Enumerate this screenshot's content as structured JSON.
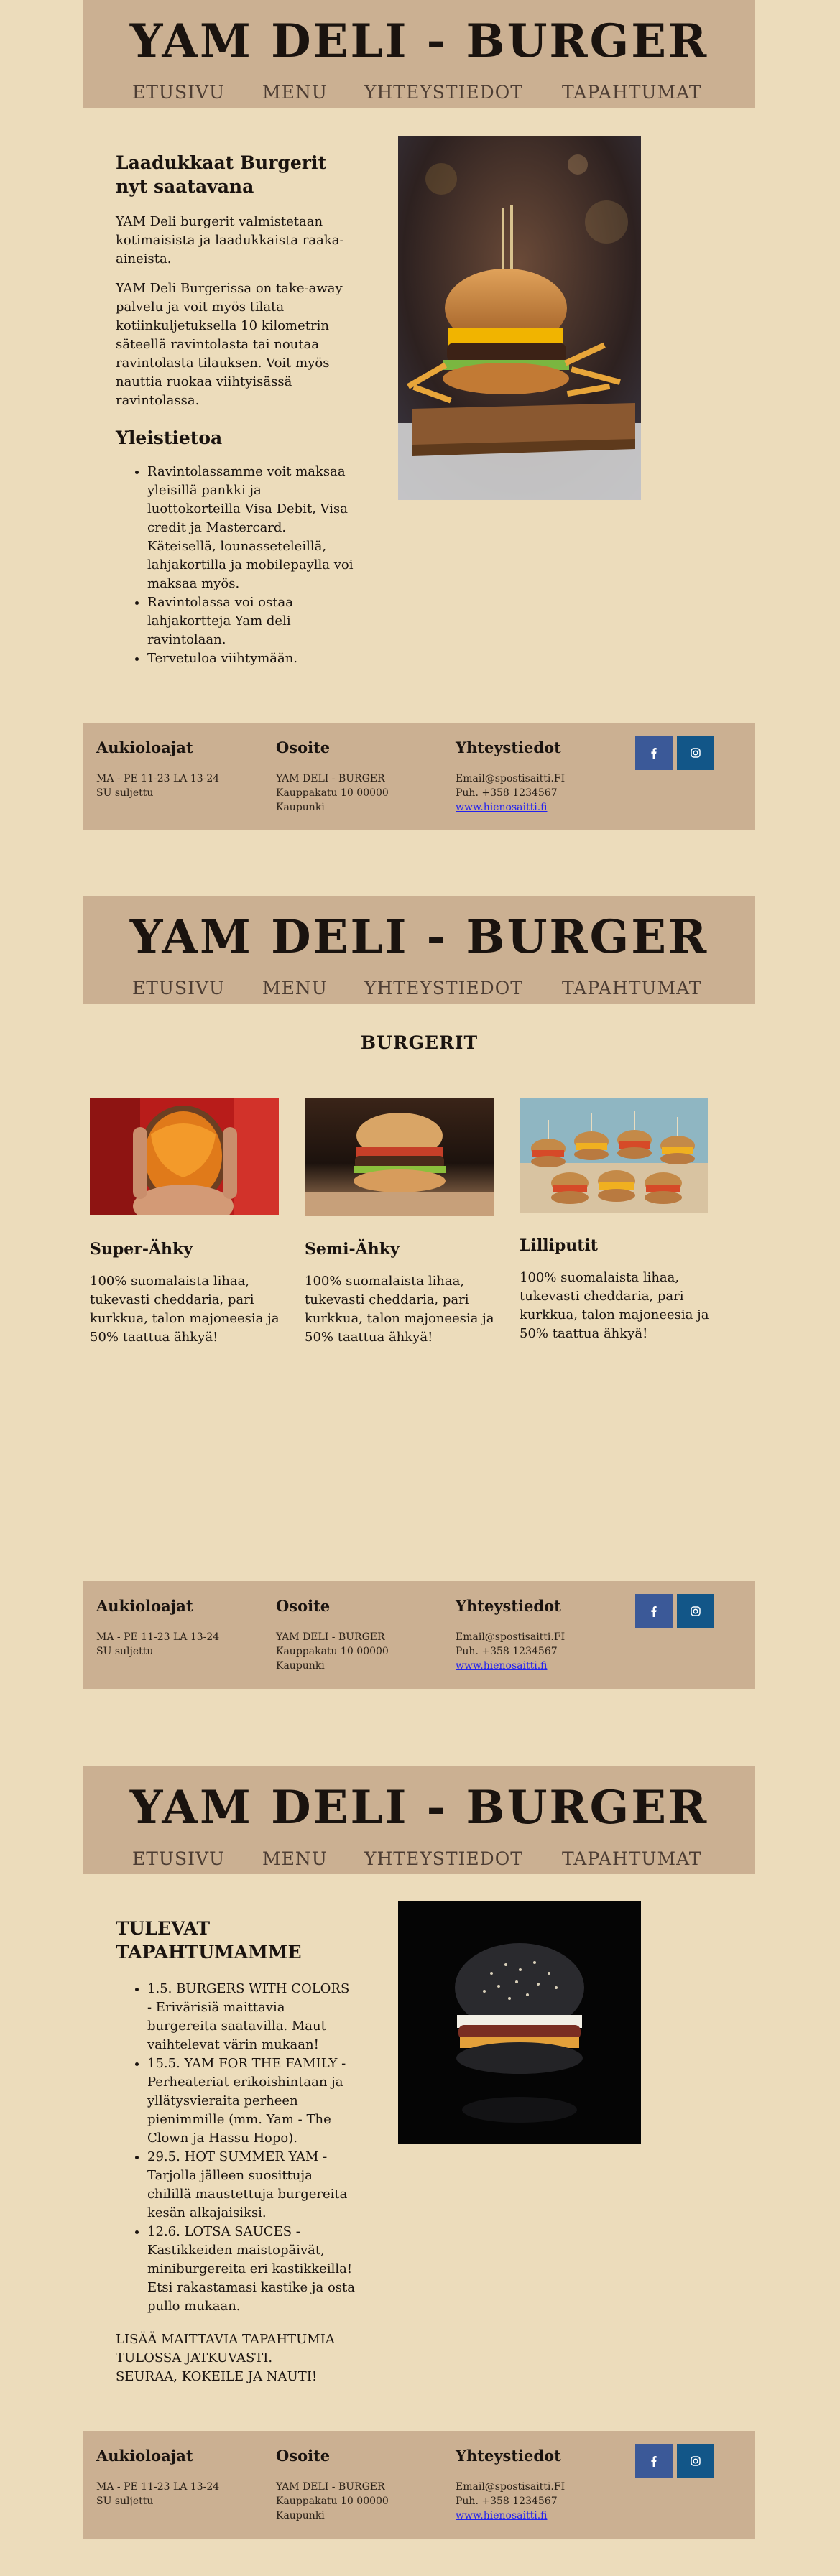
{
  "site": {
    "title": "YAM DELI - BURGER",
    "nav": [
      "ETUSIVU",
      "MENU",
      "YHTEYSTIEDOT",
      "TAPAHTUMAT"
    ]
  },
  "footer": {
    "hours_title": "Aukioloajat",
    "hours": [
      "MA - PE 11-23 LA 13-24",
      "SU suljettu"
    ],
    "address_title": "Osoite",
    "address": [
      "YAM DELI - BURGER",
      "Kauppakatu 10 00000",
      "Kaupunki"
    ],
    "contact_title": "Yhteystiedot",
    "contact": [
      "Email@spostisaitti.FI",
      "Puh. +358 1234567"
    ],
    "website": "www.hienosaitti.fi",
    "social_icons": [
      "facebook-icon",
      "instagram-icon"
    ],
    "colors": {
      "facebook": "#3b5998",
      "instagram": "#125688"
    }
  },
  "home": {
    "heading": "Laadukkaat Burgerit nyt saatavana",
    "paragraphs": [
      "YAM Deli burgerit valmistetaan kotimaisista ja laadukkaista raaka-aineista.",
      "YAM Deli Burgerissa on take-away palvelu ja voit myös tilata kotiinkuljetuksella 10 kilometrin säteellä ravintolasta tai noutaa ravintolasta tilauksen. Voit myös nauttia ruokaa viihtyisässä ravintolassa."
    ],
    "info_heading": "Yleistietoa",
    "info_items": [
      "Ravintolassamme voit maksaa yleisillä pankki ja luottokorteilla Visa Debit, Visa credit ja Mastercard. Käteisellä, lounasseteleillä, lahjakortilla ja mobilepaylla voi maksaa myös.",
      "Ravintolassa voi ostaa lahjakortteja Yam deli ravintolaan.",
      "Tervetuloa viihtymään."
    ]
  },
  "menu": {
    "heading": "BURGERIT",
    "items": [
      {
        "name": "Super-Ähky",
        "description": "100% suomalaista lihaa, tukevasti cheddaria, pari kurkkua, talon majoneesia ja 50% taattua ähkyä!"
      },
      {
        "name": "Semi-Ähky",
        "description": "100% suomalaista lihaa, tukevasti cheddaria, pari kurkkua, talon majoneesia ja 50% taattua ähkyä!"
      },
      {
        "name": "Lilliputit",
        "description": "100% suomalaista lihaa, tukevasti cheddaria, pari kurkkua, talon majoneesia ja 50% taattua ähkyä!"
      }
    ]
  },
  "events": {
    "heading": "TULEVAT TAPAHTUMAMME",
    "items": [
      "1.5. BURGERS WITH COLORS - Erivärisiä maittavia burgereita saatavilla. Maut vaihtelevat värin mukaan!",
      "15.5. YAM FOR THE FAMILY - Perheateriat erikoishintaan ja yllätysvieraita perheen pienimmille (mm. Yam - The Clown ja Hassu Hopo).",
      "29.5. HOT SUMMER YAM - Tarjolla jälleen suosittuja chilillä maustettuja burgereita kesän alkajaisiksi.",
      "12.6. LOTSA SAUCES - Kastikkeiden maistopäivät, miniburgereita eri kastikkeilla! Etsi rakastamasi kastike ja osta pullo mukaan."
    ],
    "closing": [
      "LISÄÄ MAITTAVIA TAPAHTUMIA TULOSSA JATKUVASTI.",
      "SEURAA, KOKEILE JA NAUTI!"
    ]
  }
}
